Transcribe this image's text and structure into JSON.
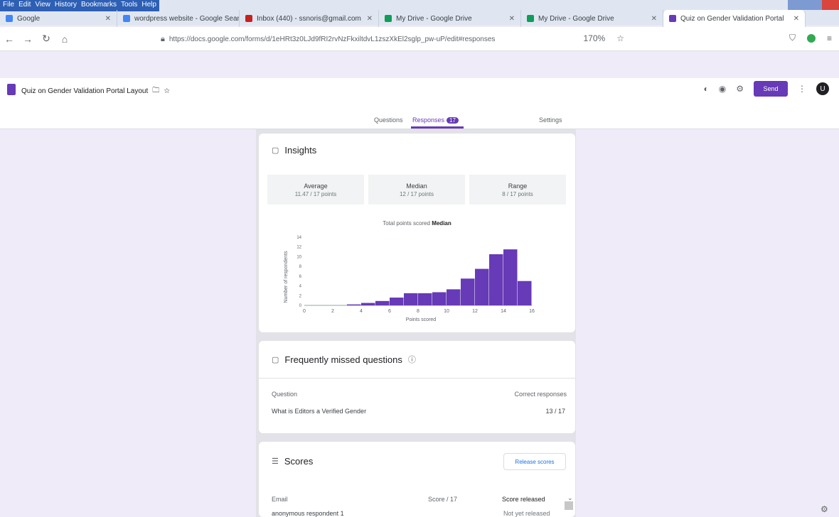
{
  "window": {
    "menu": [
      "File",
      "Edit",
      "View",
      "History",
      "Bookmarks",
      "Tools",
      "Help"
    ]
  },
  "tabs": [
    {
      "label": "Google",
      "color": "#4285f4"
    },
    {
      "label": "wordpress website - Google Search",
      "color": "#4285f4"
    },
    {
      "label": "Inbox (440) - ssnoris@gmail.com",
      "color": "#c5221f"
    },
    {
      "label": "My Drive - Google Drive",
      "color": "#0f9d58"
    },
    {
      "label": "My Drive - Google Drive",
      "color": "#0f9d58"
    },
    {
      "label": "Quiz on Gender Validation Portal",
      "color": "#673ab7"
    }
  ],
  "address": {
    "url": "https://docs.google.com/forms/d/1eHRt3z0LJd9fRI2rvNzFkxiltdvL1zszXkEl2sglp_pw-uP/edit#responses",
    "zoom": "170%"
  },
  "form": {
    "title": "Quiz on Gender Validation Portal Layout",
    "send_label": "Send",
    "avatar_initial": "U",
    "tabs": {
      "questions": "Questions",
      "responses": "Responses",
      "responses_count": "17",
      "settings": "Settings"
    }
  },
  "insights": {
    "title": "Insights",
    "stats": [
      {
        "label": "Average",
        "value": "11.47 / 17 points"
      },
      {
        "label": "Median",
        "value": "12 / 17 points"
      },
      {
        "label": "Range",
        "value": "8 / 17 points"
      }
    ],
    "chart_caption_prefix": "Total points scored",
    "chart_caption_bold": "Median"
  },
  "chart_data": {
    "type": "bar",
    "title": "",
    "xlabel": "Points scored",
    "ylabel": "Number of respondents",
    "categories": [
      "0",
      "1",
      "2",
      "3",
      "4",
      "5",
      "6",
      "7",
      "8",
      "9",
      "10",
      "11",
      "12",
      "13",
      "14",
      "15",
      "16"
    ],
    "values": [
      0,
      0,
      0,
      0.2,
      0.5,
      0.9,
      1.6,
      2.5,
      2.5,
      2.7,
      3.3,
      5.5,
      7.5,
      10.5,
      11.5,
      5.0,
      0
    ],
    "xticks": [
      "0",
      "2",
      "4",
      "6",
      "8",
      "10",
      "12",
      "14",
      "16"
    ],
    "yticks": [
      "0",
      "2",
      "4",
      "6",
      "8",
      "10",
      "12",
      "14"
    ],
    "ylim": [
      0,
      14
    ],
    "color": "#673ab7",
    "grid": false
  },
  "missed": {
    "title": "Frequently missed questions",
    "col_question": "Question",
    "col_correct": "Correct responses",
    "rows": [
      {
        "question": "What is Editors a Verified Gender",
        "correct": "13 / 17"
      }
    ]
  },
  "scores": {
    "title": "Scores",
    "release_label": "Release scores",
    "col_email": "Email",
    "col_score": "Score / 17",
    "col_released": "Score released",
    "rows": [
      {
        "email": "anonymous respondent 1",
        "score": "",
        "released": "Not yet released"
      }
    ]
  }
}
